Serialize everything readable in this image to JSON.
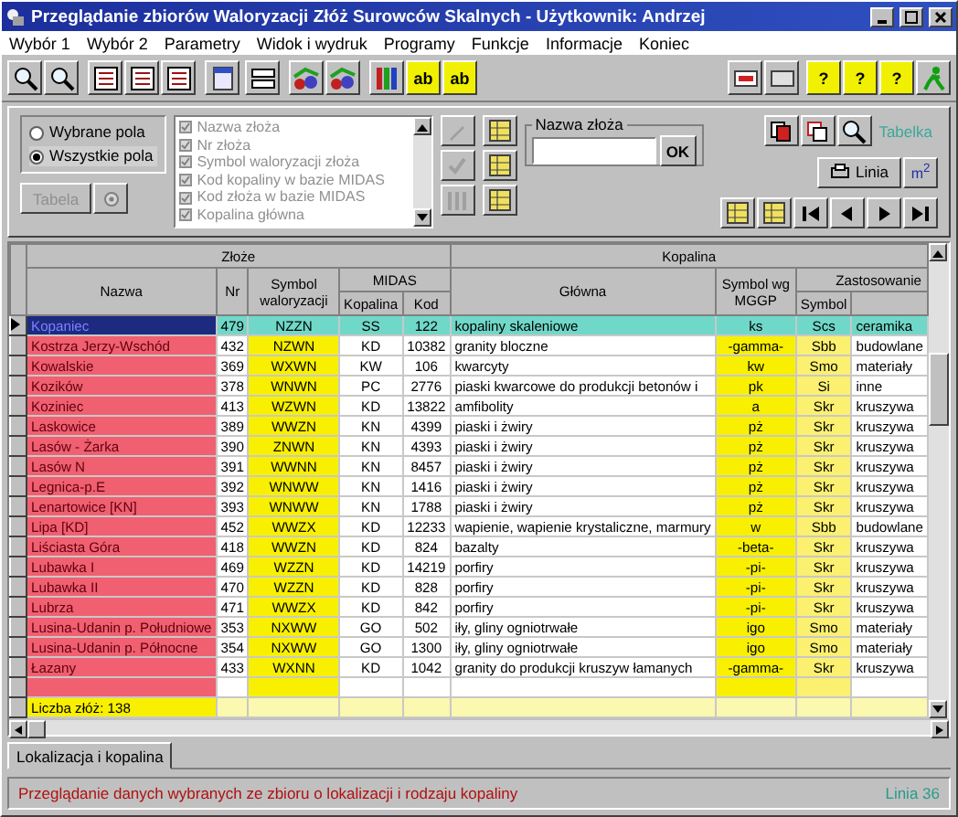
{
  "window": {
    "title": "Przeglądanie zbiorów Waloryzacji Złóż Surowców Skalnych  - Użytkownik: Andrzej"
  },
  "menu": [
    "Wybór 1",
    "Wybór 2",
    "Parametry",
    "Widok i wydruk",
    "Programy",
    "Funkcje",
    "Informacje",
    "Koniec"
  ],
  "toolbar": {
    "text_buttons": [
      "ab",
      "ab"
    ],
    "help_buttons": [
      "?",
      "?",
      "?"
    ]
  },
  "field_mode": [
    {
      "label": "Wybrane pola",
      "selected": false
    },
    {
      "label": "Wszystkie pola",
      "selected": true
    }
  ],
  "table_button": {
    "label": "Tabela",
    "disabled": true
  },
  "fields_disabled": true,
  "fields": [
    {
      "label": "Nazwa złoża",
      "checked": true
    },
    {
      "label": "Nr złoża",
      "checked": true
    },
    {
      "label": "Symbol waloryzacji złoża",
      "checked": true
    },
    {
      "label": "Kod kopaliny w bazie MIDAS",
      "checked": true
    },
    {
      "label": "Kod złoża w bazie MIDAS",
      "checked": true
    },
    {
      "label": "Kopalina główna",
      "checked": true
    }
  ],
  "search": {
    "label": "Nazwa złoża",
    "button": "OK"
  },
  "tabelka_button": "Tabelka",
  "linia_button": "Linia",
  "area_button": "m$^{2}$",
  "grid": {
    "group_left": "Złoże",
    "group_right": "Kopalina",
    "midas": "MIDAS",
    "zastosowanie": "Zastosowanie",
    "columns": [
      "Nazwa",
      "Nr",
      "Symbol waloryzacji",
      "Kopalina",
      "Kod",
      "Główna",
      "Symbol wg MGGP",
      "Symbol"
    ],
    "rows": [
      {
        "selected": true,
        "cells": [
          "Kopaniec",
          "479",
          "NZZN",
          "SS",
          "122",
          "kopaliny skaleniowe",
          "ks",
          "Scs",
          "ceramika"
        ]
      },
      {
        "selected": false,
        "cells": [
          "Kostrza Jerzy-Wschód",
          "432",
          "NZWN",
          "KD",
          "10382",
          "granity bloczne",
          "-gamma-",
          "Sbb",
          "budowlane"
        ]
      },
      {
        "selected": false,
        "cells": [
          "Kowalskie",
          "369",
          "WXWN",
          "KW",
          "106",
          "kwarcyty",
          "kw",
          "Smo",
          "materiały"
        ]
      },
      {
        "selected": false,
        "cells": [
          "Kozików",
          "378",
          "WNWN",
          "PC",
          "2776",
          "piaski kwarcowe do produkcji betonów i",
          "pk",
          "Si",
          "inne"
        ]
      },
      {
        "selected": false,
        "cells": [
          "Koziniec",
          "413",
          "WZWN",
          "KD",
          "13822",
          "amfibolity",
          "a",
          "Skr",
          "kruszywa"
        ]
      },
      {
        "selected": false,
        "cells": [
          "Laskowice",
          "389",
          "WWZN",
          "KN",
          "4399",
          "piaski i żwiry",
          "pż",
          "Skr",
          "kruszywa"
        ]
      },
      {
        "selected": false,
        "cells": [
          "Lasów - Żarka",
          "390",
          "ZNWN",
          "KN",
          "4393",
          "piaski i żwiry",
          "pż",
          "Skr",
          "kruszywa"
        ]
      },
      {
        "selected": false,
        "cells": [
          "Lasów N",
          "391",
          "WWNN",
          "KN",
          "8457",
          "piaski i żwiry",
          "pż",
          "Skr",
          "kruszywa"
        ]
      },
      {
        "selected": false,
        "cells": [
          "Legnica-p.E",
          "392",
          "WNWW",
          "KN",
          "1416",
          "piaski i żwiry",
          "pż",
          "Skr",
          "kruszywa"
        ]
      },
      {
        "selected": false,
        "cells": [
          "Lenartowice [KN]",
          "393",
          "WNWW",
          "KN",
          "1788",
          "piaski i żwiry",
          "pż",
          "Skr",
          "kruszywa"
        ]
      },
      {
        "selected": false,
        "cells": [
          "Lipa [KD]",
          "452",
          "WWZX",
          "KD",
          "12233",
          "wapienie, wapienie krystaliczne, marmury",
          "w",
          "Sbb",
          "budowlane"
        ]
      },
      {
        "selected": false,
        "cells": [
          "Liściasta Góra",
          "418",
          "WWZN",
          "KD",
          "824",
          "bazalty",
          "-beta-",
          "Skr",
          "kruszywa"
        ]
      },
      {
        "selected": false,
        "cells": [
          "Lubawka I",
          "469",
          "WZZN",
          "KD",
          "14219",
          "porfiry",
          "-pi-",
          "Skr",
          "kruszywa"
        ]
      },
      {
        "selected": false,
        "cells": [
          "Lubawka II",
          "470",
          "WZZN",
          "KD",
          "828",
          "porfiry",
          "-pi-",
          "Skr",
          "kruszywa"
        ]
      },
      {
        "selected": false,
        "cells": [
          "Lubrza",
          "471",
          "WWZX",
          "KD",
          "842",
          "porfiry",
          "-pi-",
          "Skr",
          "kruszywa"
        ]
      },
      {
        "selected": false,
        "cells": [
          "Lusina-Udanin p. Południowe",
          "353",
          "NXWW",
          "GO",
          "502",
          "iły, gliny ogniotrwałe",
          "igo",
          "Smo",
          "materiały"
        ]
      },
      {
        "selected": false,
        "cells": [
          "Lusina-Udanin p. Północne",
          "354",
          "NXWW",
          "GO",
          "1300",
          "iły, gliny ogniotrwałe",
          "igo",
          "Smo",
          "materiały"
        ]
      },
      {
        "selected": false,
        "cells": [
          "Łazany",
          "433",
          "WXNN",
          "KD",
          "1042",
          "granity do produkcji kruszyw łamanych",
          "-gamma-",
          "Skr",
          "kruszywa"
        ]
      }
    ],
    "footer": "Liczba złóż: 138"
  },
  "tabs": [
    {
      "label": "Lokalizacja i kopalina",
      "selected": true
    }
  ],
  "status_bar": {
    "message": "Przeglądanie danych wybranych ze zbioru o lokalizacji i rodzaju kopaliny",
    "line": "Linia 36"
  }
}
